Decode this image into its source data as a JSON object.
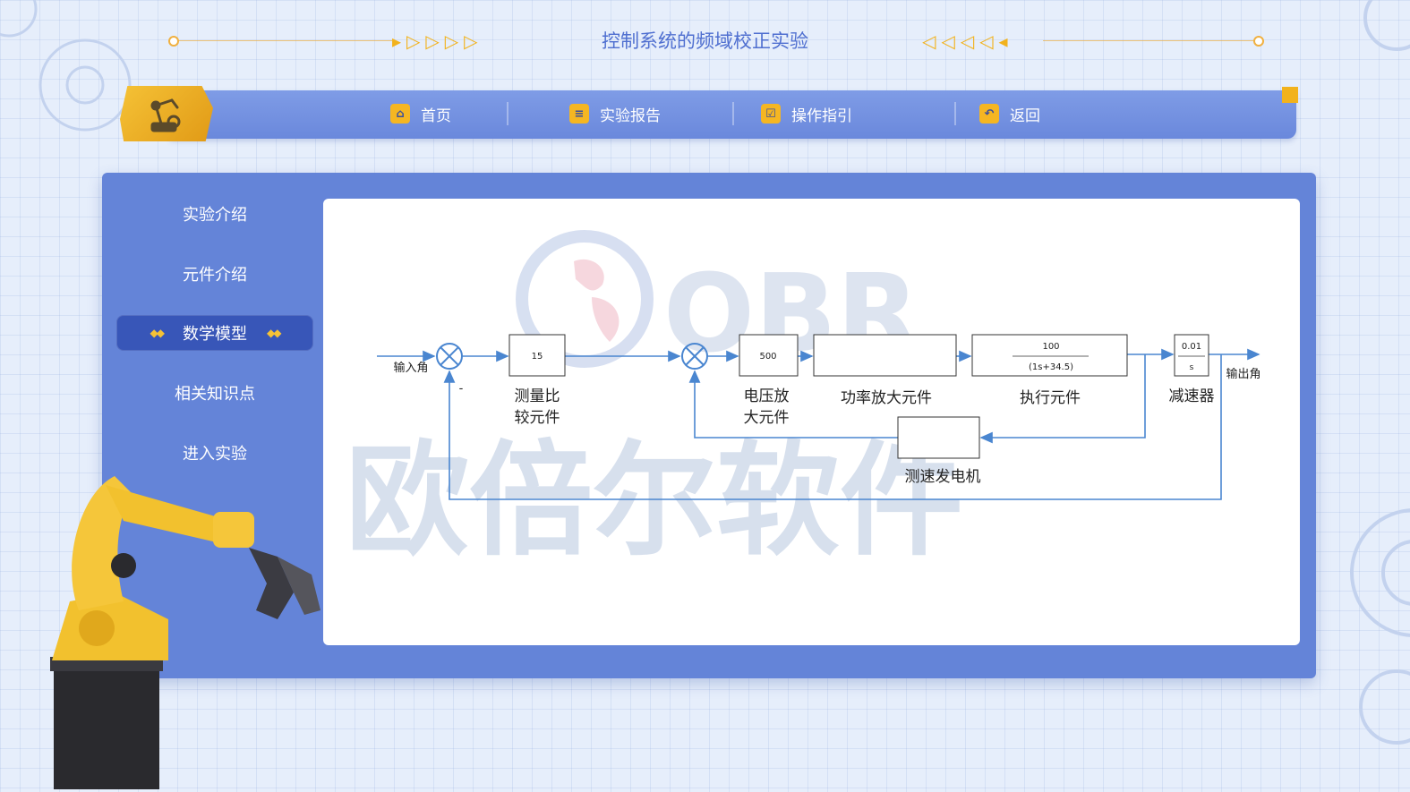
{
  "header": {
    "title": "控制系统的频域校正实验"
  },
  "nav": {
    "items": [
      {
        "label": "首页",
        "icon": "home-icon"
      },
      {
        "label": "实验报告",
        "icon": "report-icon"
      },
      {
        "label": "操作指引",
        "icon": "clipboard-icon"
      },
      {
        "label": "返回",
        "icon": "back-arrow-icon"
      }
    ]
  },
  "sidebar": {
    "items": [
      {
        "label": "实验介绍",
        "active": false
      },
      {
        "label": "元件介绍",
        "active": false
      },
      {
        "label": "数学模型",
        "active": true
      },
      {
        "label": "相关知识点",
        "active": false
      },
      {
        "label": "进入实验",
        "active": false
      }
    ]
  },
  "watermark": {
    "logo": "OBR",
    "text": "欧倍尔软件"
  },
  "diagram": {
    "input_label": "输入角",
    "output_label": "输出角",
    "minus_sign": "-",
    "blocks": {
      "compare": {
        "tf": "15",
        "label_line1": "测量比",
        "label_line2": "较元件"
      },
      "voltage_amp": {
        "tf": "500",
        "label_line1": "电压放",
        "label_line2": "大元件"
      },
      "power_amp": {
        "tf": "",
        "label": "功率放大元件"
      },
      "actuator": {
        "num": "100",
        "den": "(1s+34.5)",
        "label": "执行元件"
      },
      "reducer": {
        "num": "0.01",
        "den": "s",
        "label": "减速器"
      },
      "tacho": {
        "label": "测速发电机"
      }
    }
  },
  "colors": {
    "accent": "#f2b21c",
    "nav_bg": "#7090e0",
    "panel_bg": "#6484d8",
    "active_item": "#3856b8",
    "line": "#4a86d0",
    "title": "#4f6fd0"
  }
}
